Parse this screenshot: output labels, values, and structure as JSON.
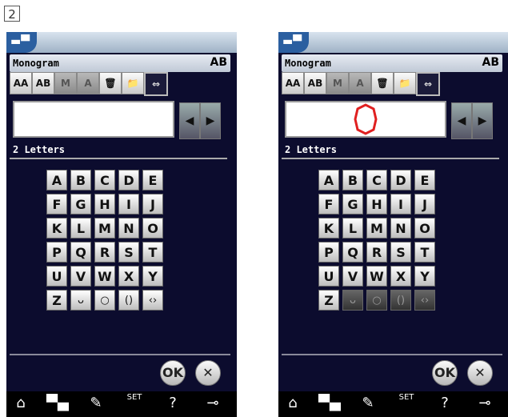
{
  "step_number": "2",
  "panels": [
    {
      "id": "left",
      "title": "Monogram",
      "title_badge": "AB",
      "selected_text": "",
      "letters_label": "2 Letters",
      "letters": [
        "A",
        "B",
        "C",
        "D",
        "E",
        "F",
        "G",
        "H",
        "I",
        "J",
        "K",
        "L",
        "M",
        "N",
        "O",
        "P",
        "Q",
        "R",
        "S",
        "T",
        "U",
        "V",
        "W",
        "X",
        "Y",
        "Z"
      ],
      "symbols": [
        "wreath-frame",
        "circle-frame",
        "brace-frame",
        "angle-frame"
      ],
      "symbols_enabled": true
    },
    {
      "id": "right",
      "title": "Monogram",
      "title_badge": "AB",
      "selected_text": "◯",
      "letters_label": "2 Letters",
      "letters": [
        "A",
        "B",
        "C",
        "D",
        "E",
        "F",
        "G",
        "H",
        "I",
        "J",
        "K",
        "L",
        "M",
        "N",
        "O",
        "P",
        "Q",
        "R",
        "S",
        "T",
        "U",
        "V",
        "W",
        "X",
        "Y",
        "Z"
      ],
      "symbols": [
        "wreath-frame",
        "circle-frame",
        "brace-frame",
        "angle-frame"
      ],
      "symbols_enabled": false
    }
  ],
  "toolbar": {
    "font_label": "AA",
    "ab_label": "AB",
    "size_label": "M",
    "style_label": "A"
  },
  "nav": {
    "left_arrow": "◀",
    "right_arrow": "▶"
  },
  "buttons": {
    "ok": "OK",
    "cancel": "✕"
  },
  "bottom_bar": {
    "home": "⌂",
    "machine": "▀▄",
    "edit": "✎",
    "set": "SET",
    "help": "?",
    "lock": "⊸"
  },
  "colors": {
    "screen_bg": "#0c0c2e",
    "accent": "#2b5fa0",
    "selection": "#e02020"
  }
}
